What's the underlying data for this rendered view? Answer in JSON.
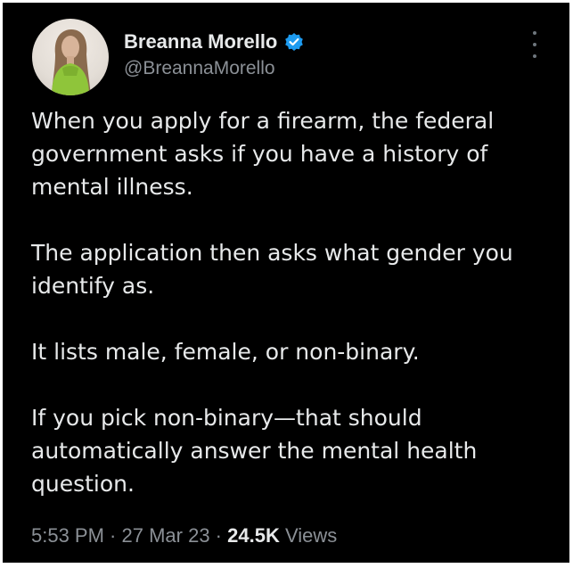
{
  "author": {
    "display_name": "Breanna Morello",
    "handle": "@BreannaMorello",
    "verified_icon": "verified-badge-icon",
    "avatar_icon": "profile-photo"
  },
  "tweet": {
    "paragraphs": [
      "When you apply for a firearm, the federal government asks if you have a history of mental illness.",
      "The application then asks what gender you identify as.",
      "It lists male, female, or non-binary.",
      "If you pick non-binary—that should automatically answer the mental health question."
    ]
  },
  "meta": {
    "time": "5:53 PM",
    "separator": " · ",
    "date": "27 Mar 23",
    "views_count": "24.5K",
    "views_label": "Views"
  },
  "colors": {
    "background": "#000000",
    "text": "#e7e9ea",
    "muted": "#8b9096",
    "verified": "#1d9bf0"
  }
}
